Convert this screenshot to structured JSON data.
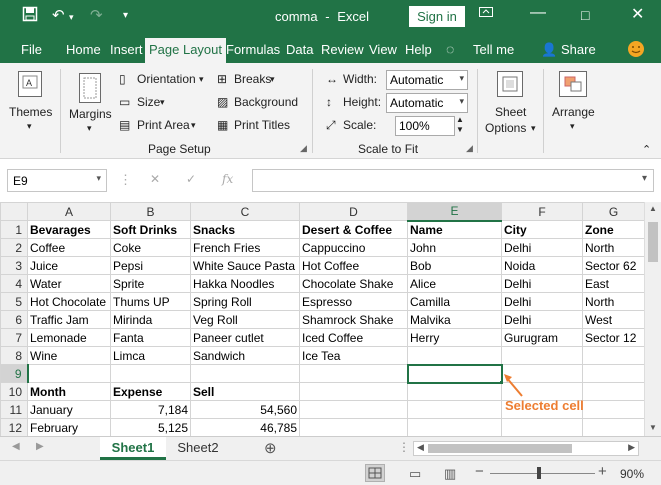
{
  "titlebar": {
    "doc_title": "comma",
    "separator": "-",
    "app_name": "Excel",
    "signin_label": "Sign in",
    "save_icon": "save-icon",
    "undo_icon": "undo-icon",
    "redo_icon": "redo-icon",
    "customize_icon": "customize-qat-icon"
  },
  "tabs": [
    "File",
    "Home",
    "Insert",
    "Page Layout",
    "Formulas",
    "Data",
    "Review",
    "View",
    "Help",
    "Tell me",
    "Share"
  ],
  "active_tab": "Page Layout",
  "ribbon": {
    "themes_label": "Themes",
    "margins_label": "Margins",
    "orientation_label": "Orientation",
    "size_label": "Size",
    "print_area_label": "Print Area",
    "breaks_label": "Breaks",
    "background_label": "Background",
    "print_titles_label": "Print Titles",
    "page_setup_label": "Page Setup",
    "width_label": "Width:",
    "width_value": "Automatic",
    "height_label": "Height:",
    "height_value": "Automatic",
    "scale_label": "Scale:",
    "scale_value": "100%",
    "scale_to_fit_label": "Scale to Fit",
    "sheet_options_line1": "Sheet",
    "sheet_options_line2": "Options",
    "arrange_label": "Arrange"
  },
  "formula_bar": {
    "name_box": "E9",
    "fx_label": "fx",
    "formula": ""
  },
  "sheet": {
    "columns": [
      "A",
      "B",
      "C",
      "D",
      "E",
      "F",
      "G"
    ],
    "selected_column": "E",
    "selected_row": 9,
    "selected_cell": "E9",
    "rows": [
      {
        "n": "1",
        "cells": [
          "Bevarages",
          "Soft Drinks",
          "Snacks",
          "Desert & Coffee",
          "Name",
          "City",
          "Zone"
        ]
      },
      {
        "n": "2",
        "cells": [
          "Coffee",
          "Coke",
          "French Fries",
          "Cappuccino",
          "John",
          "Delhi",
          "North"
        ]
      },
      {
        "n": "3",
        "cells": [
          "Juice",
          "Pepsi",
          "White Sauce Pasta",
          "Hot Coffee",
          "Bob",
          "Noida",
          "Sector 62"
        ]
      },
      {
        "n": "4",
        "cells": [
          "Water",
          "Sprite",
          "Hakka Noodles",
          "Chocolate Shake",
          "Alice",
          "Delhi",
          "East"
        ]
      },
      {
        "n": "5",
        "cells": [
          "Hot Chocolate",
          "Thums UP",
          "Spring Roll",
          "Espresso",
          "Camilla",
          "Delhi",
          "North"
        ]
      },
      {
        "n": "6",
        "cells": [
          "Traffic Jam",
          "Mirinda",
          "Veg Roll",
          "Shamrock Shake",
          "Malvika",
          "Delhi",
          "West"
        ]
      },
      {
        "n": "7",
        "cells": [
          "Lemonade",
          "Fanta",
          "Paneer cutlet",
          "Iced Coffee",
          "Herry",
          "Gurugram",
          "Sector 12"
        ]
      },
      {
        "n": "8",
        "cells": [
          "Wine",
          "Limca",
          "Sandwich",
          "Ice Tea",
          "",
          "",
          ""
        ]
      },
      {
        "n": "9",
        "cells": [
          "",
          "",
          "",
          "",
          "",
          "",
          ""
        ]
      },
      {
        "n": "10",
        "cells": [
          "Month",
          "Expense",
          "Sell",
          "",
          "",
          "",
          ""
        ]
      },
      {
        "n": "11",
        "cells": [
          "January",
          "7,184",
          "54,560",
          "",
          "",
          "",
          ""
        ]
      },
      {
        "n": "12",
        "cells": [
          "February",
          "5,125",
          "46,785",
          "",
          "",
          "",
          ""
        ]
      }
    ]
  },
  "annotation": {
    "text": "Selected cell",
    "color": "#ed7d31"
  },
  "sheet_tabs": [
    "Sheet1",
    "Sheet2"
  ],
  "active_sheet": "Sheet1",
  "status": {
    "zoom": "90%"
  },
  "colors": {
    "excel_green": "#217346",
    "accent_orange": "#ed7d31"
  }
}
